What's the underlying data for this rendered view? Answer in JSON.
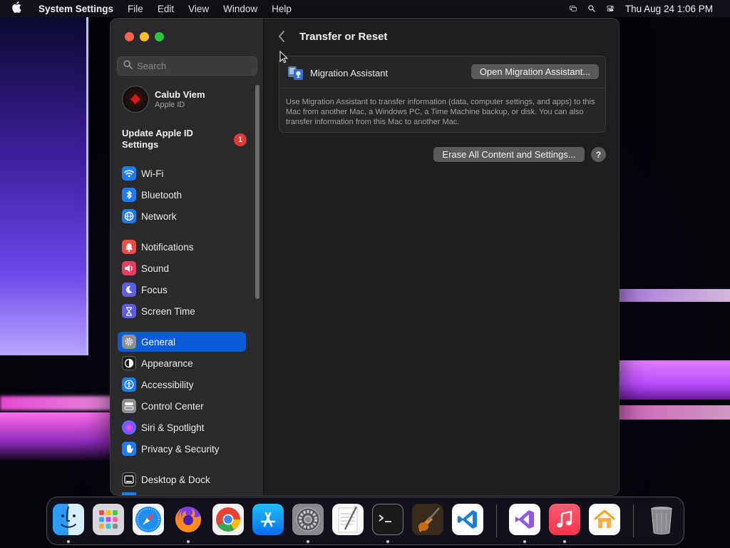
{
  "menubar": {
    "app_name": "System Settings",
    "menus": [
      "File",
      "Edit",
      "View",
      "Window",
      "Help"
    ],
    "datetime": "Thu Aug 24  1:06 PM"
  },
  "sidebar": {
    "search_placeholder": "Search",
    "account": {
      "name": "Calub Viem",
      "subtitle": "Apple ID"
    },
    "update": {
      "label": "Update Apple ID Settings",
      "badge": "1"
    },
    "items": [
      {
        "label": "Wi-Fi",
        "icon": "wifi-icon",
        "color": "#1e7cf2"
      },
      {
        "label": "Bluetooth",
        "icon": "bluetooth-icon",
        "color": "#1e7cf2"
      },
      {
        "label": "Network",
        "icon": "globe-icon",
        "color": "#1e7cf2"
      },
      {
        "label": "Notifications",
        "icon": "bell-icon",
        "color": "#ec4d4b"
      },
      {
        "label": "Sound",
        "icon": "speaker-icon",
        "color": "#ec3e64"
      },
      {
        "label": "Focus",
        "icon": "moon-icon",
        "color": "#5e5ce6"
      },
      {
        "label": "Screen Time",
        "icon": "hourglass-icon",
        "color": "#5e5ce6"
      },
      {
        "label": "General",
        "icon": "gear-icon",
        "color": "#8e8e93"
      },
      {
        "label": "Appearance",
        "icon": "appearance-icon",
        "color": "#1c1c1e"
      },
      {
        "label": "Accessibility",
        "icon": "accessibility-icon",
        "color": "#1e7cf2"
      },
      {
        "label": "Control Center",
        "icon": "control-center-icon",
        "color": "#8e8e93"
      },
      {
        "label": "Siri & Spotlight",
        "icon": "siri-icon",
        "color": "#a04fe0"
      },
      {
        "label": "Privacy & Security",
        "icon": "hand-icon",
        "color": "#1e7cf2"
      },
      {
        "label": "Desktop & Dock",
        "icon": "dock-icon",
        "color": "#1c1c1e"
      }
    ],
    "selected": "General"
  },
  "content": {
    "title": "Transfer or Reset",
    "migration": {
      "label": "Migration Assistant",
      "button": "Open Migration Assistant...",
      "description": "Use Migration Assistant to transfer information (data, computer settings, and apps) to this Mac from another Mac, a Windows PC, a Time Machine backup, or disk. You can also transfer information from this Mac to another Mac."
    },
    "erase_button": "Erase All Content and Settings...",
    "help_label": "?"
  },
  "dock": {
    "apps": [
      {
        "name": "Finder",
        "icon": "finder-icon",
        "running": true
      },
      {
        "name": "Launchpad",
        "icon": "launchpad-icon",
        "running": false
      },
      {
        "name": "Safari",
        "icon": "safari-icon",
        "running": false
      },
      {
        "name": "Firefox",
        "icon": "firefox-icon",
        "running": true
      },
      {
        "name": "Chrome",
        "icon": "chrome-icon",
        "running": false
      },
      {
        "name": "App Store",
        "icon": "app-store-icon",
        "running": false
      },
      {
        "name": "System Settings",
        "icon": "system-settings-icon",
        "running": true
      },
      {
        "name": "TextEdit",
        "icon": "textedit-icon",
        "running": false
      },
      {
        "name": "Terminal",
        "icon": "terminal-icon",
        "running": true
      },
      {
        "name": "GarageBand",
        "icon": "garageband-icon",
        "running": false
      },
      {
        "name": "Visual Studio Code",
        "icon": "vscode-icon",
        "running": false
      },
      {
        "name": "Visual Studio",
        "icon": "visual-studio-icon",
        "running": true
      },
      {
        "name": "Music",
        "icon": "music-icon",
        "running": true
      },
      {
        "name": "Home",
        "icon": "home-icon",
        "running": false
      },
      {
        "name": "Trash",
        "icon": "trash-icon",
        "running": false
      }
    ]
  }
}
